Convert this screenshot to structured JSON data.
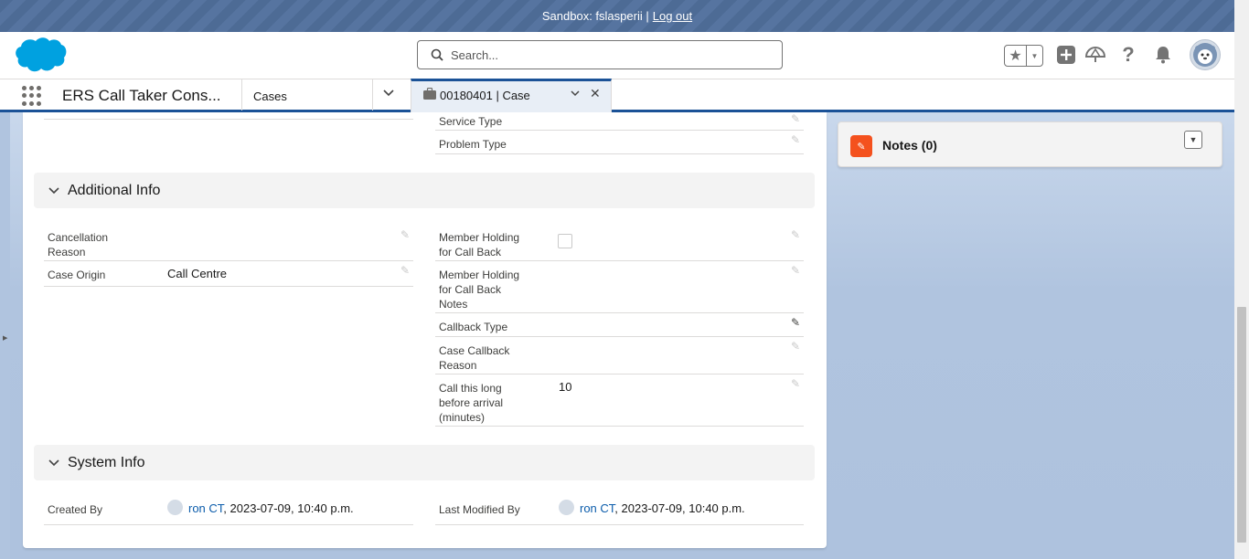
{
  "sandbox": {
    "text": "Sandbox: fslasperii |",
    "logout": "Log out"
  },
  "header": {
    "search_placeholder": "Search...",
    "icons": [
      "favorites-star-icon",
      "favorites-menu-icon",
      "add-icon",
      "trailhead-icon",
      "help-icon",
      "notifications-bell-icon",
      "user-avatar"
    ]
  },
  "nav": {
    "app_name": "ERS Call Taker Cons...",
    "cases_label": "Cases",
    "active_tab_label": "00180401 | Case"
  },
  "top_fields": {
    "service_type": "Service Type",
    "problem_type": "Problem Type"
  },
  "sections": {
    "additional_info": "Additional Info",
    "system_info": "System Info"
  },
  "additional_info": {
    "cancellation_reason_label": "Cancellation Reason",
    "case_origin_label": "Case Origin",
    "case_origin_value": "Call Centre",
    "member_holding_label": "Member Holding for Call Back",
    "member_holding_notes_label": "Member Holding for Call Back Notes",
    "callback_type_label": "Callback Type",
    "case_callback_reason_label": "Case Callback Reason",
    "call_long_label": "Call this long before arrival (minutes)",
    "call_long_value": "10"
  },
  "system_info": {
    "created_by_label": "Created By",
    "created_by_user": "ron CT",
    "created_by_date": ", 2023-07-09, 10:40 p.m.",
    "modified_by_label": "Last Modified By",
    "modified_by_user": "ron CT",
    "modified_by_date": ", 2023-07-09, 10:40 p.m."
  },
  "notes": {
    "title": "Notes (0)"
  }
}
